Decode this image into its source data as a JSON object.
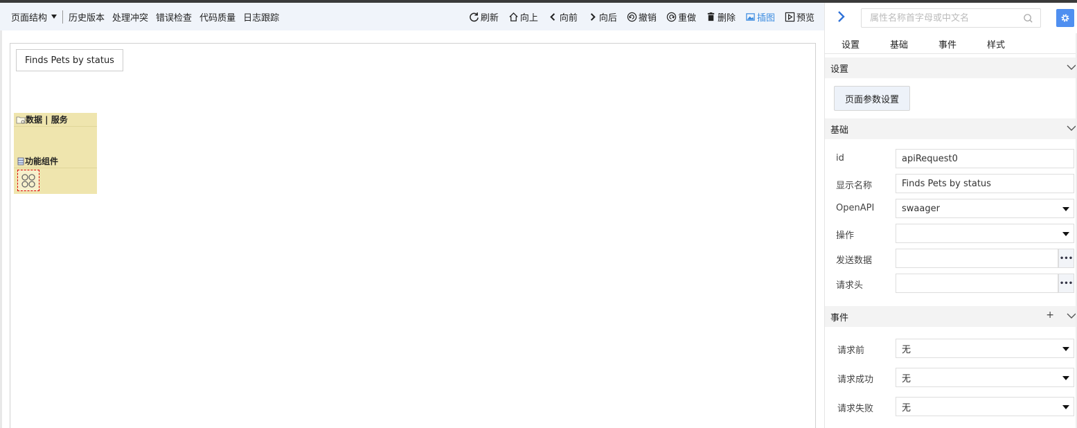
{
  "toolbar": {
    "page_structure": "页面结构",
    "left_items": [
      "历史版本",
      "处理冲突",
      "错误检查",
      "代码质量",
      "日志跟踪"
    ],
    "refresh": "刷新",
    "up": "向上",
    "prev": "向前",
    "next": "向后",
    "undo": "撤销",
    "redo": "重做",
    "delete": "删除",
    "insert_image": "插图",
    "preview": "预览",
    "accent": "#3b8be0"
  },
  "canvas": {
    "button_label": "Finds Pets by status",
    "panel_data_title": "数据 | 服务",
    "panel_func_title": "功能组件"
  },
  "right_panel": {
    "search_placeholder": "属性名称首字母或中文名",
    "tabs": [
      "设置",
      "基础",
      "事件",
      "样式"
    ],
    "section_settings": "设置",
    "param_button": "页面参数设置",
    "section_basic": "基础",
    "fields": {
      "id_label": "id",
      "id_value": "apiRequest0",
      "name_label": "显示名称",
      "name_value": "Finds Pets by status",
      "openapi_label": "OpenAPI",
      "openapi_value": "swaager",
      "op_label": "操作",
      "op_value": "",
      "send_label": "发送数据",
      "send_value": "",
      "header_label": "请求头",
      "header_value": ""
    },
    "section_events": "事件",
    "plus": "+",
    "events": {
      "before_label": "请求前",
      "before_value": "无",
      "success_label": "请求成功",
      "success_value": "无",
      "fail_label": "请求失败",
      "fail_value": "无"
    },
    "gear_color": "#4f8ff0"
  }
}
